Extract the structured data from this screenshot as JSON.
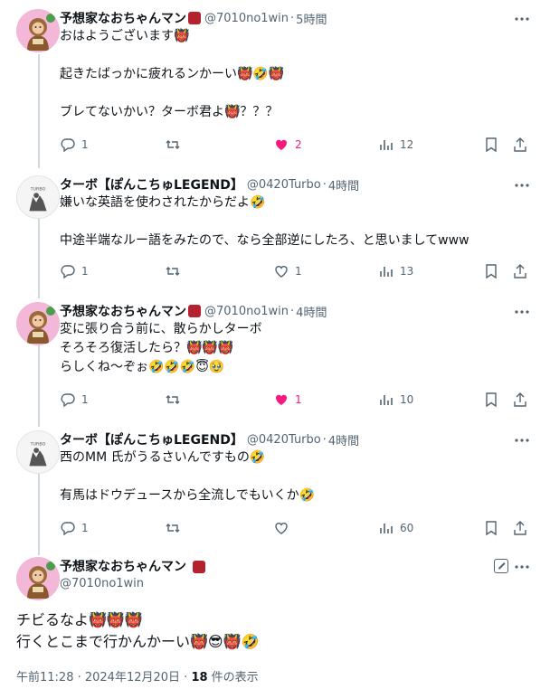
{
  "tweets": [
    {
      "author": "予想家なおちゃんマン",
      "handle": "@7010no1win",
      "time": "5時間",
      "text": "おはようございます👹\n\n起きたばっかに疲れるンかーい👹🤣👹\n\nブレてないかい？ターボ君よ👹？？？",
      "replies": "1",
      "retweets": "",
      "likes": "2",
      "liked": true,
      "views": "12"
    },
    {
      "author": "ターボ【ぽんこちゅLEGEND】",
      "handle": "@0420Turbo",
      "time": "4時間",
      "text": "嫌いな英語を使わされたからだよ🤣\n\n中途半端なルー語をみたので、なら全部逆にしたろ、と思いましてwww",
      "replies": "1",
      "retweets": "",
      "likes": "1",
      "liked": false,
      "views": "13"
    },
    {
      "author": "予想家なおちゃんマン",
      "handle": "@7010no1win",
      "time": "4時間",
      "text": "変に張り合う前に、散らかしターボ\nそろそろ復活したら？👹👹👹\nらしくね〜ぞぉ🤣🤣🤣😇🥹",
      "replies": "1",
      "retweets": "",
      "likes": "1",
      "liked": true,
      "views": "10"
    },
    {
      "author": "ターボ【ぽんこちゅLEGEND】",
      "handle": "@0420Turbo",
      "time": "4時間",
      "text": "西のMM 氏がうるさいんですもの🤣\n\n有馬はドウデュースから全流しでもいくか🤣",
      "replies": "1",
      "retweets": "",
      "likes": "",
      "liked": false,
      "views": "60"
    }
  ],
  "main_tweet": {
    "author": "予想家なおちゃんマン",
    "handle": "@7010no1win",
    "text": "チビるなよ👹👹👹\n行くとこまで行かんかーい👹😎👹🤣",
    "timestamp": "午前11:28 · 2024年12月20日 · ",
    "views_count": "18",
    "views_label": " 件の表示"
  },
  "colors": {
    "like_active": "#f91880",
    "secondary_text": "#536471",
    "thread_line": "#cfd9de"
  }
}
